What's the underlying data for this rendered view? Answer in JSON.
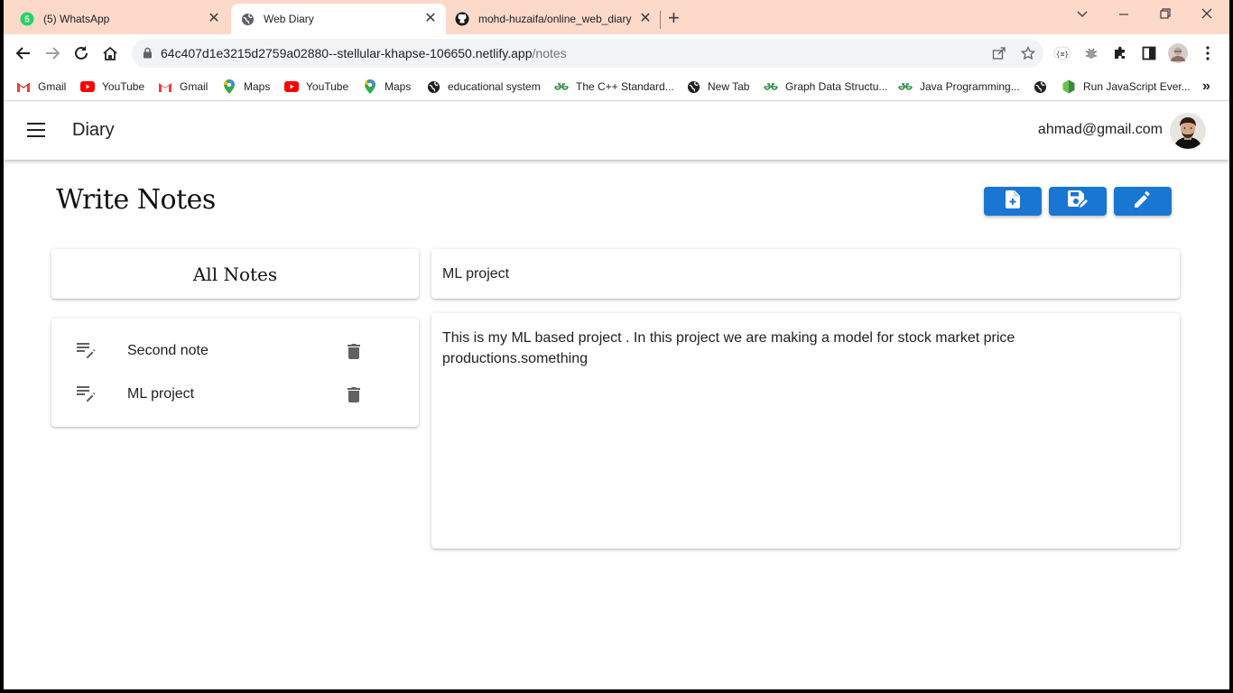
{
  "browser": {
    "tabs": [
      {
        "title": "(5) WhatsApp",
        "badge": "5",
        "active": false
      },
      {
        "title": "Web Diary",
        "active": true
      },
      {
        "title": "mohd-huzaifa/online_web_diary",
        "active": false
      }
    ],
    "url_host": "64c407d1e3215d2759a02880--stellular-khapse-106650.netlify.app",
    "url_path": "/notes",
    "bookmarks": [
      {
        "label": "Gmail",
        "icon": "gmail-icon"
      },
      {
        "label": "YouTube",
        "icon": "youtube-icon"
      },
      {
        "label": "Gmail",
        "icon": "gmail-icon"
      },
      {
        "label": "Maps",
        "icon": "maps-icon"
      },
      {
        "label": "YouTube",
        "icon": "youtube-icon"
      },
      {
        "label": "Maps",
        "icon": "maps-icon"
      },
      {
        "label": "educational system",
        "icon": "globe-icon"
      },
      {
        "label": "The C++ Standard...",
        "icon": "gfg-icon"
      },
      {
        "label": "New Tab",
        "icon": "globe-icon"
      },
      {
        "label": "Graph Data Structu...",
        "icon": "gfg-icon"
      },
      {
        "label": "Java Programming...",
        "icon": "gfg-icon"
      },
      {
        "label": "",
        "icon": "globe-icon"
      },
      {
        "label": "Run JavaScript Ever...",
        "icon": "nodejs-icon"
      }
    ],
    "overflow_label": "»"
  },
  "app": {
    "title": "Diary",
    "user_email": "ahmad@gmail.com",
    "accent_color": "#1976d2"
  },
  "page": {
    "heading": "Write Notes",
    "actions": [
      {
        "name": "new-note-button",
        "icon": "note-add-icon"
      },
      {
        "name": "save-note-button",
        "icon": "save-as-icon"
      },
      {
        "name": "edit-note-button",
        "icon": "pencil-icon"
      }
    ]
  },
  "notes_list": {
    "title": "All Notes",
    "items": [
      {
        "label": "Second note"
      },
      {
        "label": "ML project"
      }
    ]
  },
  "editor": {
    "title_value": "ML project",
    "body_value": "This is my ML based project . In this project we are making a model for stock market price productions.something"
  }
}
